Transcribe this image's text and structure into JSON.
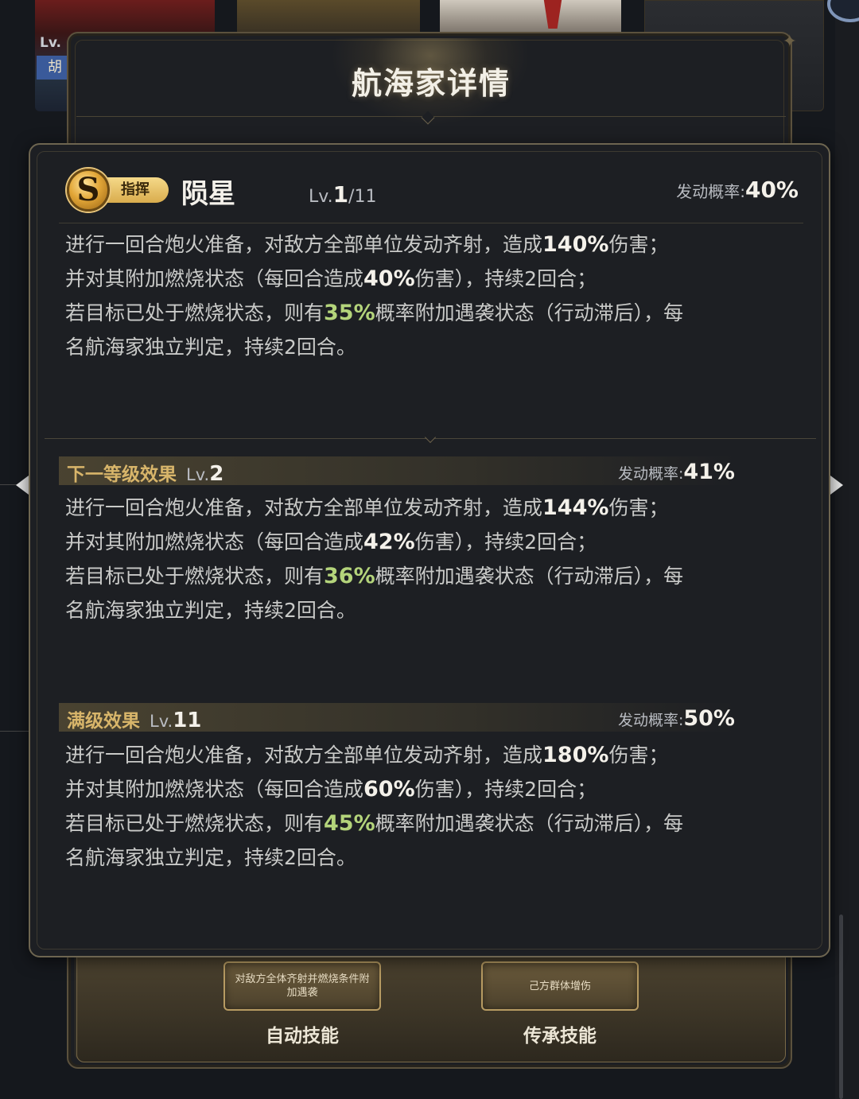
{
  "background": {
    "card_level_prefix": "Lv.",
    "card_name_fragment": "胡"
  },
  "back_panel": {
    "title": "航海家详情",
    "auto_skill_slot_text": "对敌方全体齐射并燃烧条件附加遇袭",
    "auto_skill_label": "自动技能",
    "inherit_skill_slot_text": "己方群体增伤",
    "inherit_skill_label": "传承技能"
  },
  "skill": {
    "rank_badge": "S",
    "type": "指挥",
    "name": "陨星",
    "level_prefix": "Lv.",
    "level_current": "1",
    "level_max": "/11",
    "prob_label": "发动概率:",
    "prob_value": "40%",
    "desc": {
      "l1a": "进行一回合炮火准备，对敌方全部单位发动齐射，造成",
      "l1v": "140%",
      "l1b": "伤害；",
      "l2a": "并对其附加燃烧状态（每回合造成",
      "l2v": "40%",
      "l2b": "伤害），持续2回合；",
      "l3a": "若目标已处于燃烧状态，则有",
      "l3v": "35%",
      "l3b": "概率附加遇袭状态（行动滞后），每",
      "l4": "名航海家独立判定，持续2回合。"
    }
  },
  "next_level": {
    "title": "下一等级效果",
    "lv_prefix": "Lv.",
    "lv_value": "2",
    "prob_label": "发动概率:",
    "prob_value": "41%",
    "desc": {
      "l1a": "进行一回合炮火准备，对敌方全部单位发动齐射，造成",
      "l1v": "144%",
      "l1b": "伤害；",
      "l2a": "并对其附加燃烧状态（每回合造成",
      "l2v": "42%",
      "l2b": "伤害），持续2回合；",
      "l3a": "若目标已处于燃烧状态，则有",
      "l3v": "36%",
      "l3b": "概率附加遇袭状态（行动滞后），每",
      "l4": "名航海家独立判定，持续2回合。"
    }
  },
  "max_level": {
    "title": "满级效果",
    "lv_prefix": "Lv.",
    "lv_value": "11",
    "prob_label": "发动概率:",
    "prob_value": "50%",
    "desc": {
      "l1a": "进行一回合炮火准备，对敌方全部单位发动齐射，造成",
      "l1v": "180%",
      "l1b": "伤害；",
      "l2a": "并对其附加燃烧状态（每回合造成",
      "l2v": "60%",
      "l2b": "伤害），持续2回合；",
      "l3a": "若目标已处于燃烧状态，则有",
      "l3v": "45%",
      "l3b": "概率附加遇袭状态（行动滞后），每",
      "l4": "名航海家独立判定，持续2回合。"
    }
  },
  "colors": {
    "highlight_white": "#f4f1ea",
    "highlight_green": "#b4d47b",
    "section_gold": "#d8b56a",
    "panel_bg": "#1d1f23"
  }
}
